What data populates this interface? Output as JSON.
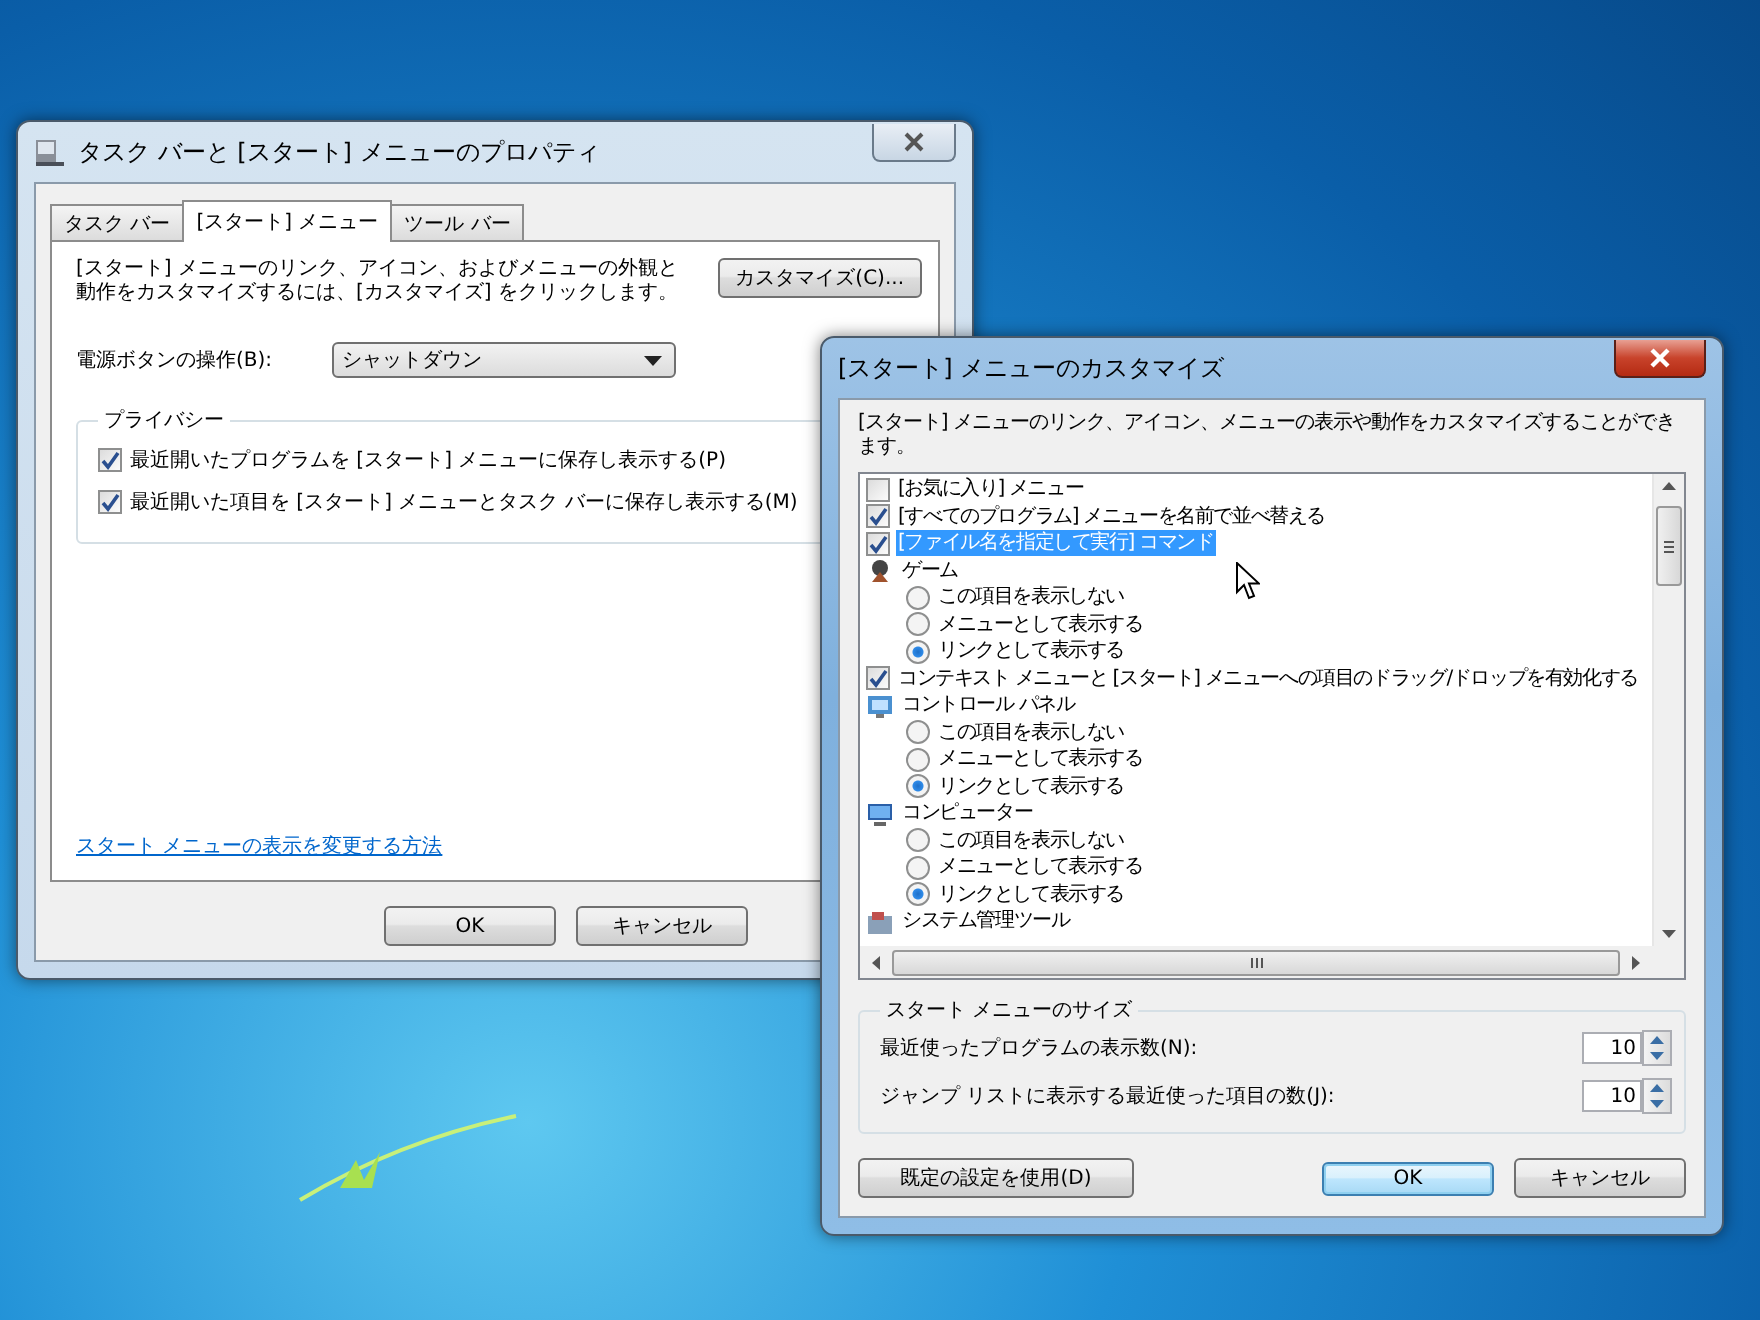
{
  "properties_window": {
    "title": "タスク バーと [スタート] メニューのプロパティ",
    "tabs": [
      {
        "label": "タスク バー",
        "selected": false
      },
      {
        "label": "[スタート] メニュー",
        "selected": true
      },
      {
        "label": "ツール バー",
        "selected": false
      }
    ],
    "description": "[スタート] メニューのリンク、アイコン、およびメニューの外観と動作をカスタマイズするには、[カスタマイズ] をクリックします。",
    "customize_button": "カスタマイズ(C)...",
    "power_button_label": "電源ボタンの操作(B):",
    "power_button_value": "シャットダウン",
    "privacy_group": {
      "title": "プライバシー",
      "options": [
        {
          "label": "最近開いたプログラムを [スタート] メニューに保存し表示する(P)",
          "checked": true
        },
        {
          "label": "最近開いた項目を [スタート] メニューとタスク バーに保存し表示する(M)",
          "checked": true
        }
      ]
    },
    "help_link": "スタート メニューの表示を変更する方法",
    "buttons": [
      "OK",
      "キャンセル"
    ]
  },
  "customize_window": {
    "title": "[スタート] メニューのカスタマイズ",
    "description": "[スタート] メニューのリンク、アイコン、メニューの表示や動作をカスタマイズすることができます。",
    "items": [
      {
        "kind": "checkbox",
        "label": "[お気に入り] メニュー",
        "checked": false,
        "selected": false
      },
      {
        "kind": "checkbox",
        "label": "[すべてのプログラム] メニューを名前で並べ替える",
        "checked": true,
        "selected": false
      },
      {
        "kind": "checkbox",
        "label": "[ファイル名を指定して実行] コマンド",
        "checked": true,
        "selected": true
      },
      {
        "kind": "group",
        "label": "ゲーム",
        "selected": false,
        "children": [
          {
            "label": "この項目を表示しない",
            "selected": false
          },
          {
            "label": "メニューとして表示する",
            "selected": false
          },
          {
            "label": "リンクとして表示する",
            "selected": true
          }
        ]
      },
      {
        "kind": "checkbox",
        "label": "コンテキスト メニューと [スタート] メニューへの項目のドラッグ/ドロップを有効化する",
        "checked": true,
        "selected": false
      },
      {
        "kind": "group",
        "label": "コントロール パネル",
        "selected": false,
        "children": [
          {
            "label": "この項目を表示しない",
            "selected": false
          },
          {
            "label": "メニューとして表示する",
            "selected": false
          },
          {
            "label": "リンクとして表示する",
            "selected": true
          }
        ]
      },
      {
        "kind": "group",
        "label": "コンピューター",
        "selected": false,
        "children": [
          {
            "label": "この項目を表示しない",
            "selected": false
          },
          {
            "label": "メニューとして表示する",
            "selected": false
          },
          {
            "label": "リンクとして表示する",
            "selected": true
          }
        ]
      },
      {
        "kind": "group",
        "label": "システム管理ツール",
        "selected": false
      }
    ],
    "size_group": {
      "title": "スタート メニューのサイズ",
      "fields": [
        {
          "label": "最近使ったプログラムの表示数(N):",
          "value": "10"
        },
        {
          "label": "ジャンプ リストに表示する最近使った項目の数(J):",
          "value": "10"
        }
      ]
    },
    "reset_button": "既定の設定を使用(D)",
    "buttons": [
      {
        "label": "OK",
        "default": true
      },
      {
        "label": "キャンセル",
        "default": false
      }
    ]
  }
}
